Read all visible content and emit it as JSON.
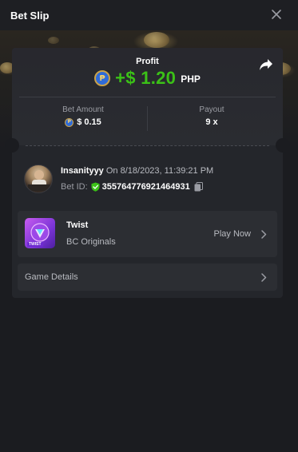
{
  "header": {
    "title": "Bet Slip"
  },
  "profit": {
    "label": "Profit",
    "coin_symbol": "₱",
    "value": "+$ 1.20",
    "currency": "PHP"
  },
  "stats": {
    "bet_amount_label": "Bet Amount",
    "bet_amount_value": "$ 0.15",
    "payout_label": "Payout",
    "payout_value": "9 x"
  },
  "bet": {
    "username": "Insanityyy",
    "timestamp": "On 8/18/2023, 11:39:21 PM",
    "bet_id_label": "Bet ID:",
    "bet_id": "355764776921464931"
  },
  "game": {
    "title": "Twist",
    "subtitle": "BC Originals",
    "action": "Play Now",
    "thumb_label": "TWIST"
  },
  "details": {
    "label": "Game Details"
  },
  "colors": {
    "profit_green": "#3bc117",
    "background": "#1b1c20",
    "card": "#24262b",
    "shield_green": "#3bc117"
  },
  "icons": [
    "close-icon",
    "share-icon",
    "php-coin-icon",
    "shield-icon",
    "copy-icon",
    "chevron-right-icon"
  ]
}
